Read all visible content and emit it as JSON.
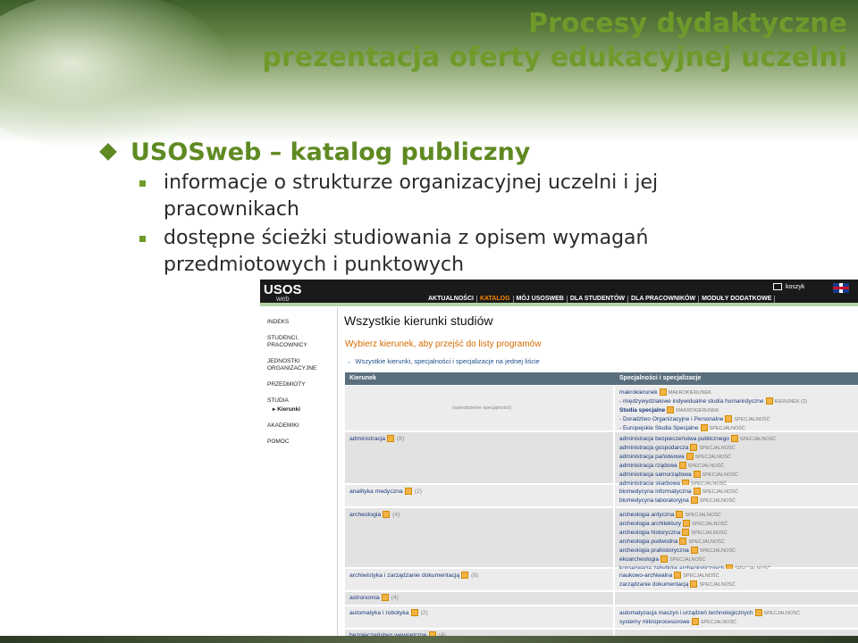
{
  "slide": {
    "title_line1": "Procesy dydaktyczne",
    "title_line2": "prezentacja oferty edukacyjnej uczelni",
    "bullet1": "USOSweb – katalog publiczny",
    "sub1_line1": "informacje o strukturze organizacyjnej uczelni i jej",
    "sub1_line2": "pracownikach",
    "sub2_line1": "dostępne ścieżki studiowania z opisem wymagań",
    "sub2_line2": "przedmiotowych i punktowych",
    "colors": {
      "accent": "#6f9a2a",
      "text": "#2b2b2b"
    }
  },
  "usos": {
    "logo": "USOS",
    "logo_sub": "web",
    "menu": [
      "AKTUALNOŚCI",
      "KATALOG",
      "MÓJ USOSWEB",
      "DLA STUDENTÓW",
      "DLA PRACOWNIKÓW",
      "MODUŁY DODATKOWE"
    ],
    "cart": "koszyk",
    "sidebar": {
      "indeks": "INDEKS",
      "studenci": "STUDENCI,",
      "studenci2": "PRACOWNICY",
      "jednostki": "JEDNOSTKI",
      "jednostki2": "ORGANIZACYJNE",
      "przedmioty": "PRZEDMIOTY",
      "studia": "STUDIA",
      "kierunki": "▸ Kierunki",
      "akademiki": "AKADEMIKI",
      "pomoc": "POMOC"
    },
    "heading": "Wszystkie kierunki studiów",
    "pick": "Wybierz kierunek, aby przejść do listy programów",
    "all_line": "Wszystkie kierunki, specjalności i specjalizacje na jednej liście",
    "th_left": "Kierunek",
    "th_right": "Specjalności i specjalizacje",
    "row0": {
      "center": "(samodzielne specjalności)",
      "r1": "makrokierunek",
      "r1s": "MAKROKIERUNEK",
      "r2": "- międzywydziałowe indywidualne studia humanistyczne",
      "r2s": "KIERUNEK (2)",
      "r3": "Studia specjalne",
      "r3s": "MAKROKIERUNEK",
      "r4": "- Doradztwo Organizacyjne i Personalne",
      "r4s": "SPECJALNOŚĆ",
      "r5": "- Europejskie Studia Specjalne",
      "r5s": "SPECJALNOŚĆ"
    },
    "row1": {
      "name": "administracja",
      "cnt": "(8)",
      "r": [
        "administracja bezpieczeństwa publicznego",
        "administracja gospodarcza",
        "administracja państwowa",
        "administracja rządowa",
        "administracja samorządowa",
        "administracja skarbowa"
      ],
      "tag": "SPECJALNOŚĆ"
    },
    "row2": {
      "name": "analityka medyczna",
      "cnt": "(2)",
      "r": [
        "biomedycyna informatyczna",
        "biomedycyna laboratoryjna"
      ]
    },
    "row3": {
      "name": "archeologia",
      "cnt": "(4)",
      "r": [
        "archeologia antyczna",
        "archeologia architektury",
        "archeologia historyczna",
        "archeologia podwodna",
        "archeologia prahistoryczna",
        "ekoarcheologia",
        "konserwacja zabytków archeologicznych"
      ]
    },
    "row4": {
      "name": "archiwistyka i zarządzanie dokumentacją",
      "cnt": "(8)",
      "r": [
        "naukowo-archiwalna",
        "zarządzanie dokumentacją"
      ]
    },
    "row5": {
      "name": "astronomia",
      "cnt": "(4)"
    },
    "row6": {
      "name": "automatyka i robotyka",
      "cnt": "(2)",
      "r": [
        "automatyzacja maszyn i urządzeń technologicznych",
        "systemy mikroprocesorowe"
      ]
    },
    "row7": {
      "name": "bezpieczeństwo wewnętrzne",
      "cnt": "(4)"
    }
  }
}
